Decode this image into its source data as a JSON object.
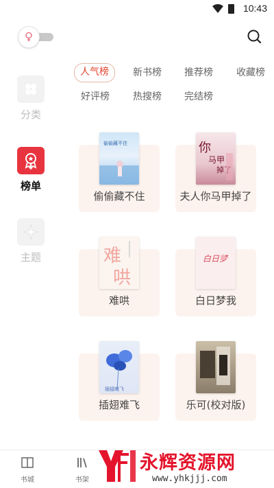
{
  "status_bar": {
    "time": "10:43"
  },
  "sidebar": {
    "items": [
      {
        "label": "分类",
        "icon": "category-icon",
        "active": false
      },
      {
        "label": "榜单",
        "icon": "rank-badge-icon",
        "active": true
      },
      {
        "label": "主题",
        "icon": "theme-icon",
        "active": false
      }
    ]
  },
  "tabs": [
    {
      "label": "人气榜",
      "active": true
    },
    {
      "label": "新书榜",
      "active": false
    },
    {
      "label": "推荐榜",
      "active": false
    },
    {
      "label": "收藏榜",
      "active": false
    },
    {
      "label": "好评榜",
      "active": false
    },
    {
      "label": "热搜榜",
      "active": false
    },
    {
      "label": "完结榜",
      "active": false
    }
  ],
  "books": [
    {
      "title": "偷偷藏不住"
    },
    {
      "title": "夫人你马甲掉了"
    },
    {
      "title": "难哄"
    },
    {
      "title": "白日梦我"
    },
    {
      "title": "插翅难飞"
    },
    {
      "title": "乐可(校对版)"
    }
  ],
  "bottom_nav": [
    {
      "label": "书城",
      "icon": "book-open-icon"
    },
    {
      "label": "书架",
      "icon": "bookshelf-icon"
    }
  ],
  "watermark": {
    "text": "永辉资源网",
    "url": "www.yhkjjj.com"
  },
  "colors": {
    "accent": "#e0452f",
    "rank_icon_bg": "#e8343f",
    "card_bg": "#fdf3ee"
  }
}
